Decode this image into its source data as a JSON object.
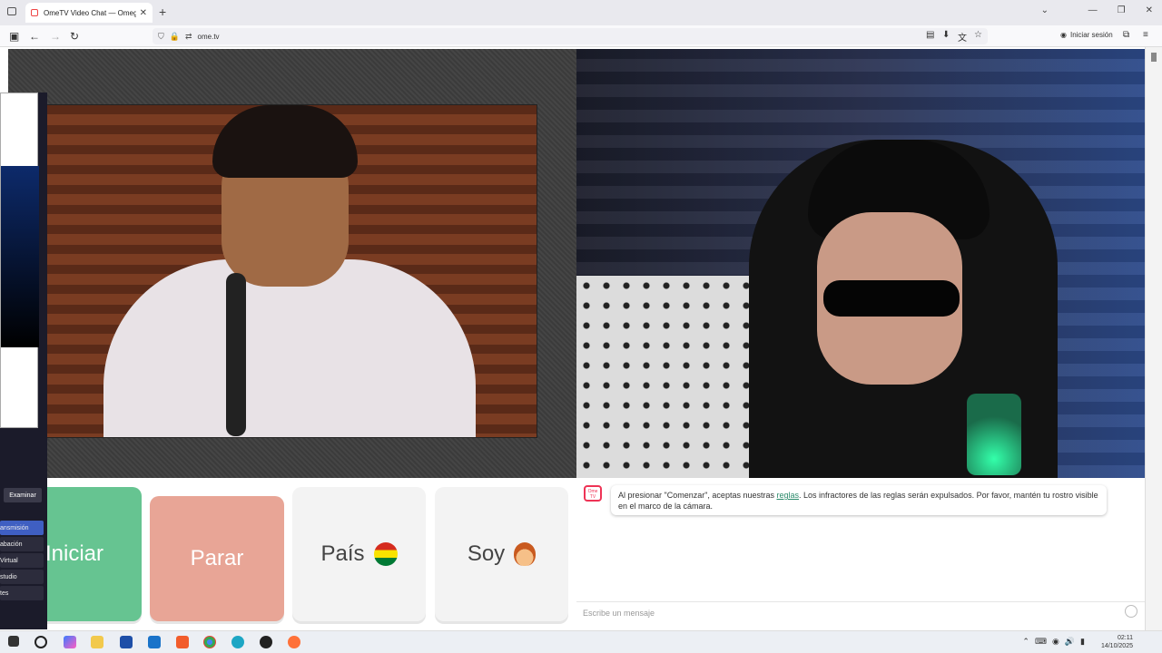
{
  "browser": {
    "tab_title": "OmeTV Video Chat — Omegle",
    "tab_close": "✕",
    "new_tab": "+",
    "url": "ome.tv",
    "signin_label": "Iniciar sesión",
    "window_controls": [
      "—",
      "❐",
      "✕"
    ],
    "tabs_dropdown": "⌄"
  },
  "side_panel": {
    "browse_button": "Examinar",
    "menu_items": [
      "ansmisión",
      "abación",
      "Virtual",
      "studio",
      "tes"
    ]
  },
  "cards": {
    "start_label": "Iniciar",
    "stop_label": "Parar",
    "country_label": "País",
    "gender_label": "Soy"
  },
  "chat": {
    "logo_text": "Ome TV",
    "message_before_link": "Al presionar \"Comenzar\", aceptas nuestras ",
    "message_link": "reglas",
    "message_after_link": ". Los infractores de las reglas serán expulsados. Por favor, mantén tu rostro visible en el marco de la cámara.",
    "input_placeholder": "Escribe un mensaje"
  },
  "taskbar": {
    "time": "02:11",
    "date": "14/10/2025",
    "tray_icons": [
      "⌃",
      "⌨",
      "◉",
      "🔊",
      "▮"
    ]
  },
  "colors": {
    "start": "#66c491",
    "stop": "#e8a596",
    "link": "#2a8a6a"
  }
}
